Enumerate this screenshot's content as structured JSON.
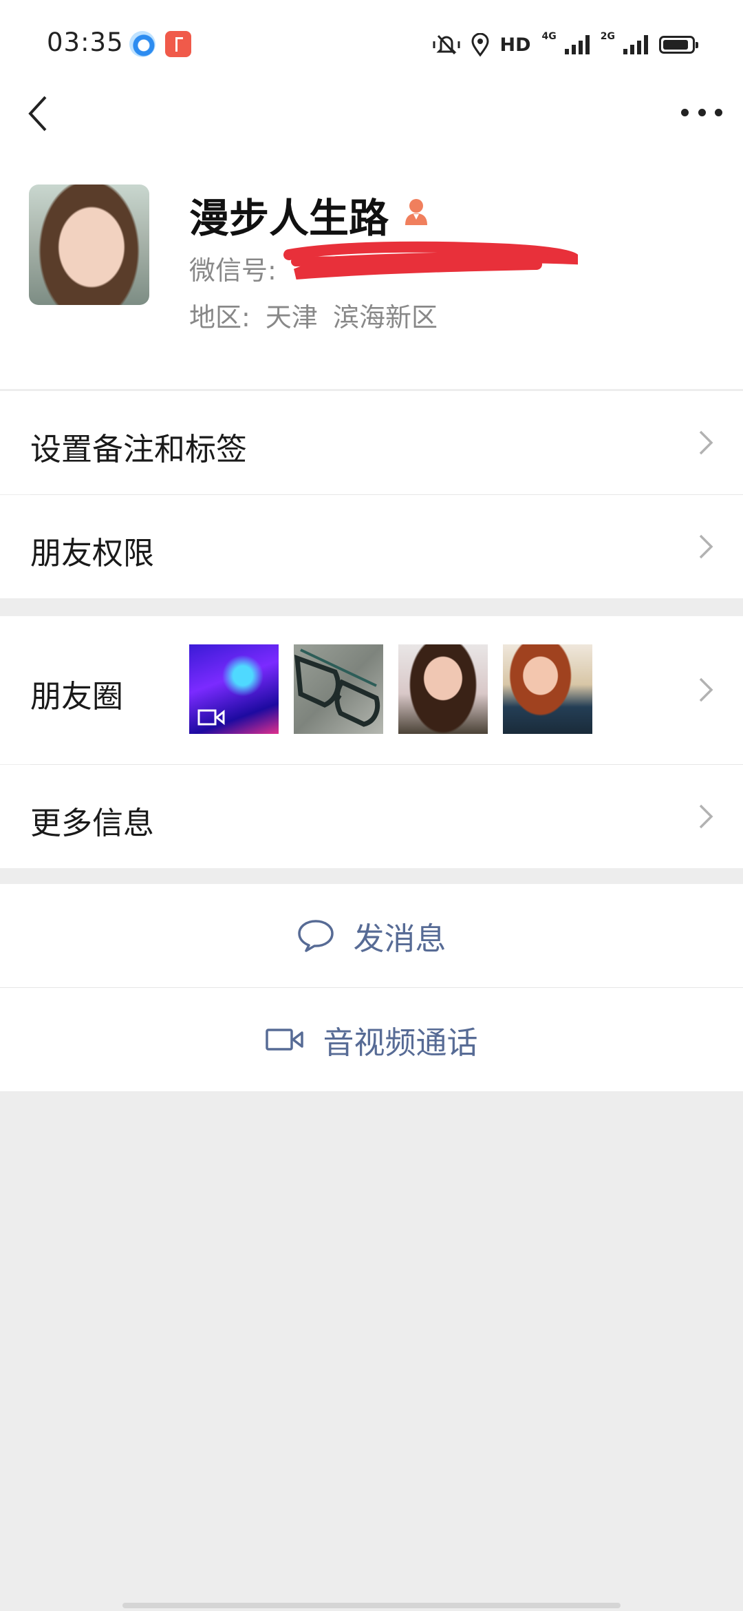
{
  "status_bar": {
    "time": "03:35",
    "hd": "HD",
    "net1": "4G",
    "net2": "2G"
  },
  "nav": {
    "back_icon": "chevron-left-icon",
    "more_icon": "more-dots-icon"
  },
  "profile": {
    "nickname": "漫步人生路",
    "wechat_id_label": "微信号:",
    "region": "地区:  天津  滨海新区"
  },
  "menu": {
    "remarks_tags": "设置备注和标签",
    "friend_permissions": "朋友权限",
    "moments": "朋友圈",
    "more_info": "更多信息"
  },
  "actions": {
    "send_message": "发消息",
    "video_call": "音视频通话"
  },
  "colors": {
    "link": "#576b95",
    "background": "#ededed",
    "redaction": "#e8303a"
  }
}
